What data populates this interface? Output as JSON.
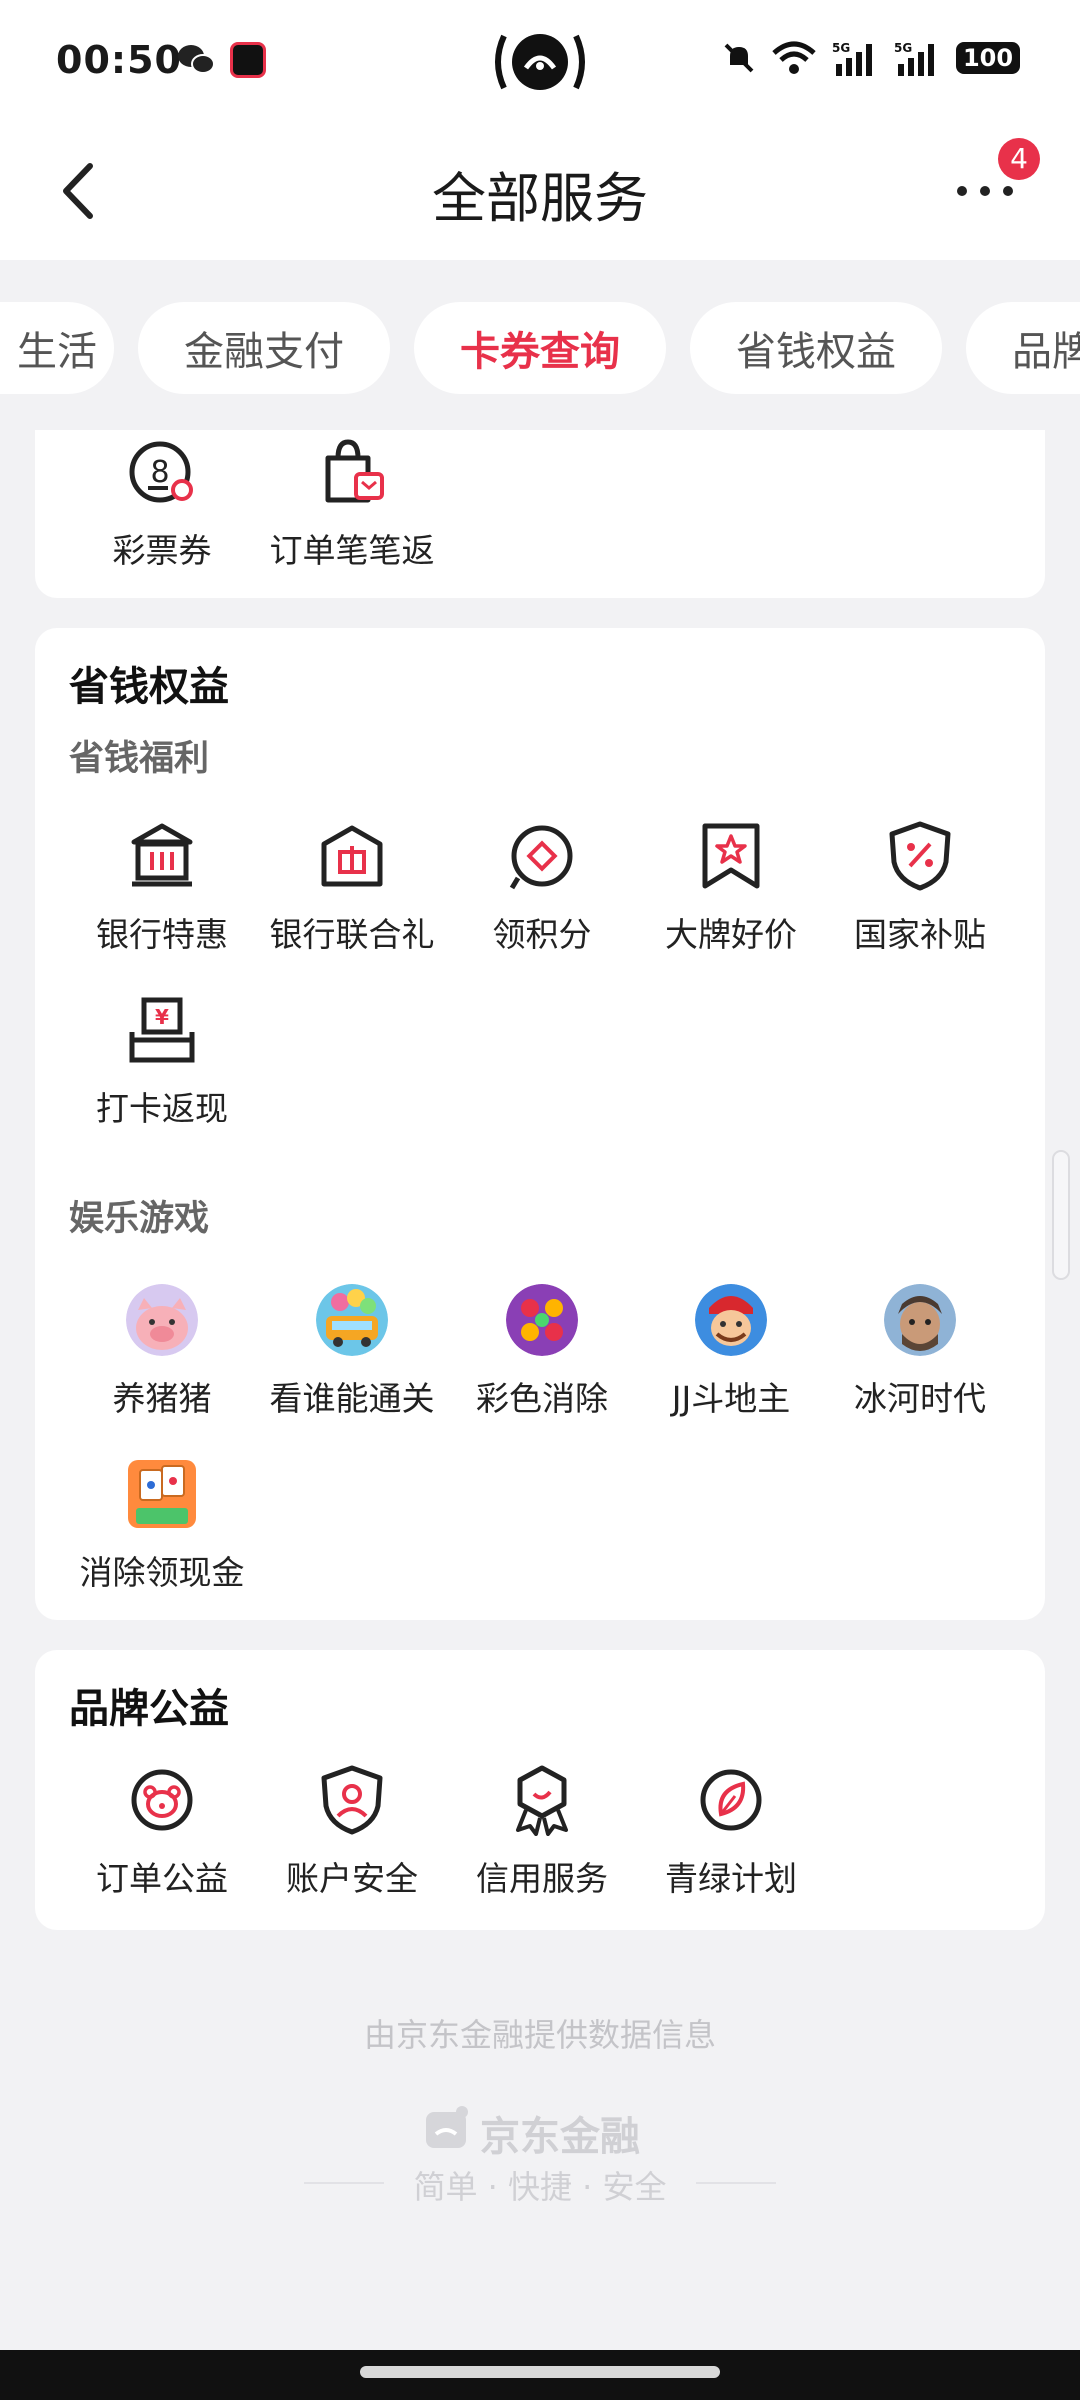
{
  "status_bar": {
    "time": "00:50",
    "battery": "100",
    "network": "5G"
  },
  "nav": {
    "title": "全部服务",
    "badge_count": "4"
  },
  "tabs": [
    {
      "label": "生活"
    },
    {
      "label": "金融支付"
    },
    {
      "label": "卡券查询"
    },
    {
      "label": "省钱权益"
    },
    {
      "label": "品牌"
    }
  ],
  "card_top": {
    "items": [
      {
        "label": "彩票券",
        "icon": "lottery-ticket-icon"
      },
      {
        "label": "订单笔笔返",
        "icon": "shopping-bag-icon"
      }
    ]
  },
  "savings_section": {
    "title": "省钱权益",
    "welfare_subtitle": "省钱福利",
    "welfare_items": [
      {
        "label": "银行特惠",
        "icon": "bank-icon"
      },
      {
        "label": "银行联合礼",
        "icon": "bank-gift-icon"
      },
      {
        "label": "领积分",
        "icon": "points-icon"
      },
      {
        "label": "大牌好价",
        "icon": "star-ribbon-icon"
      },
      {
        "label": "国家补贴",
        "icon": "percent-shield-icon"
      },
      {
        "label": "打卡返现",
        "icon": "cash-back-icon"
      }
    ],
    "games_subtitle": "娱乐游戏",
    "game_items": [
      {
        "label": "养猪猪",
        "icon": "pig-avatar-icon"
      },
      {
        "label": "看谁能通关",
        "icon": "bus-avatar-icon"
      },
      {
        "label": "彩色消除",
        "icon": "candy-avatar-icon"
      },
      {
        "label": "JJ斗地主",
        "icon": "landlord-avatar-icon"
      },
      {
        "label": "冰河时代",
        "icon": "caveman-avatar-icon"
      },
      {
        "label": "消除领现金",
        "icon": "mahjong-tile-icon"
      }
    ]
  },
  "brand_section": {
    "title": "品牌公益",
    "items": [
      {
        "label": "订单公益",
        "icon": "charity-bear-icon"
      },
      {
        "label": "账户安全",
        "icon": "account-shield-icon"
      },
      {
        "label": "信用服务",
        "icon": "credit-badge-icon"
      },
      {
        "label": "青绿计划",
        "icon": "leaf-icon"
      }
    ]
  },
  "footer": {
    "provider": "由京东金融提供数据信息",
    "brand": "京东金融",
    "slogan": "简单 · 快捷 · 安全"
  },
  "colors": {
    "accent": "#e8314a",
    "background": "#f2f2f4"
  }
}
